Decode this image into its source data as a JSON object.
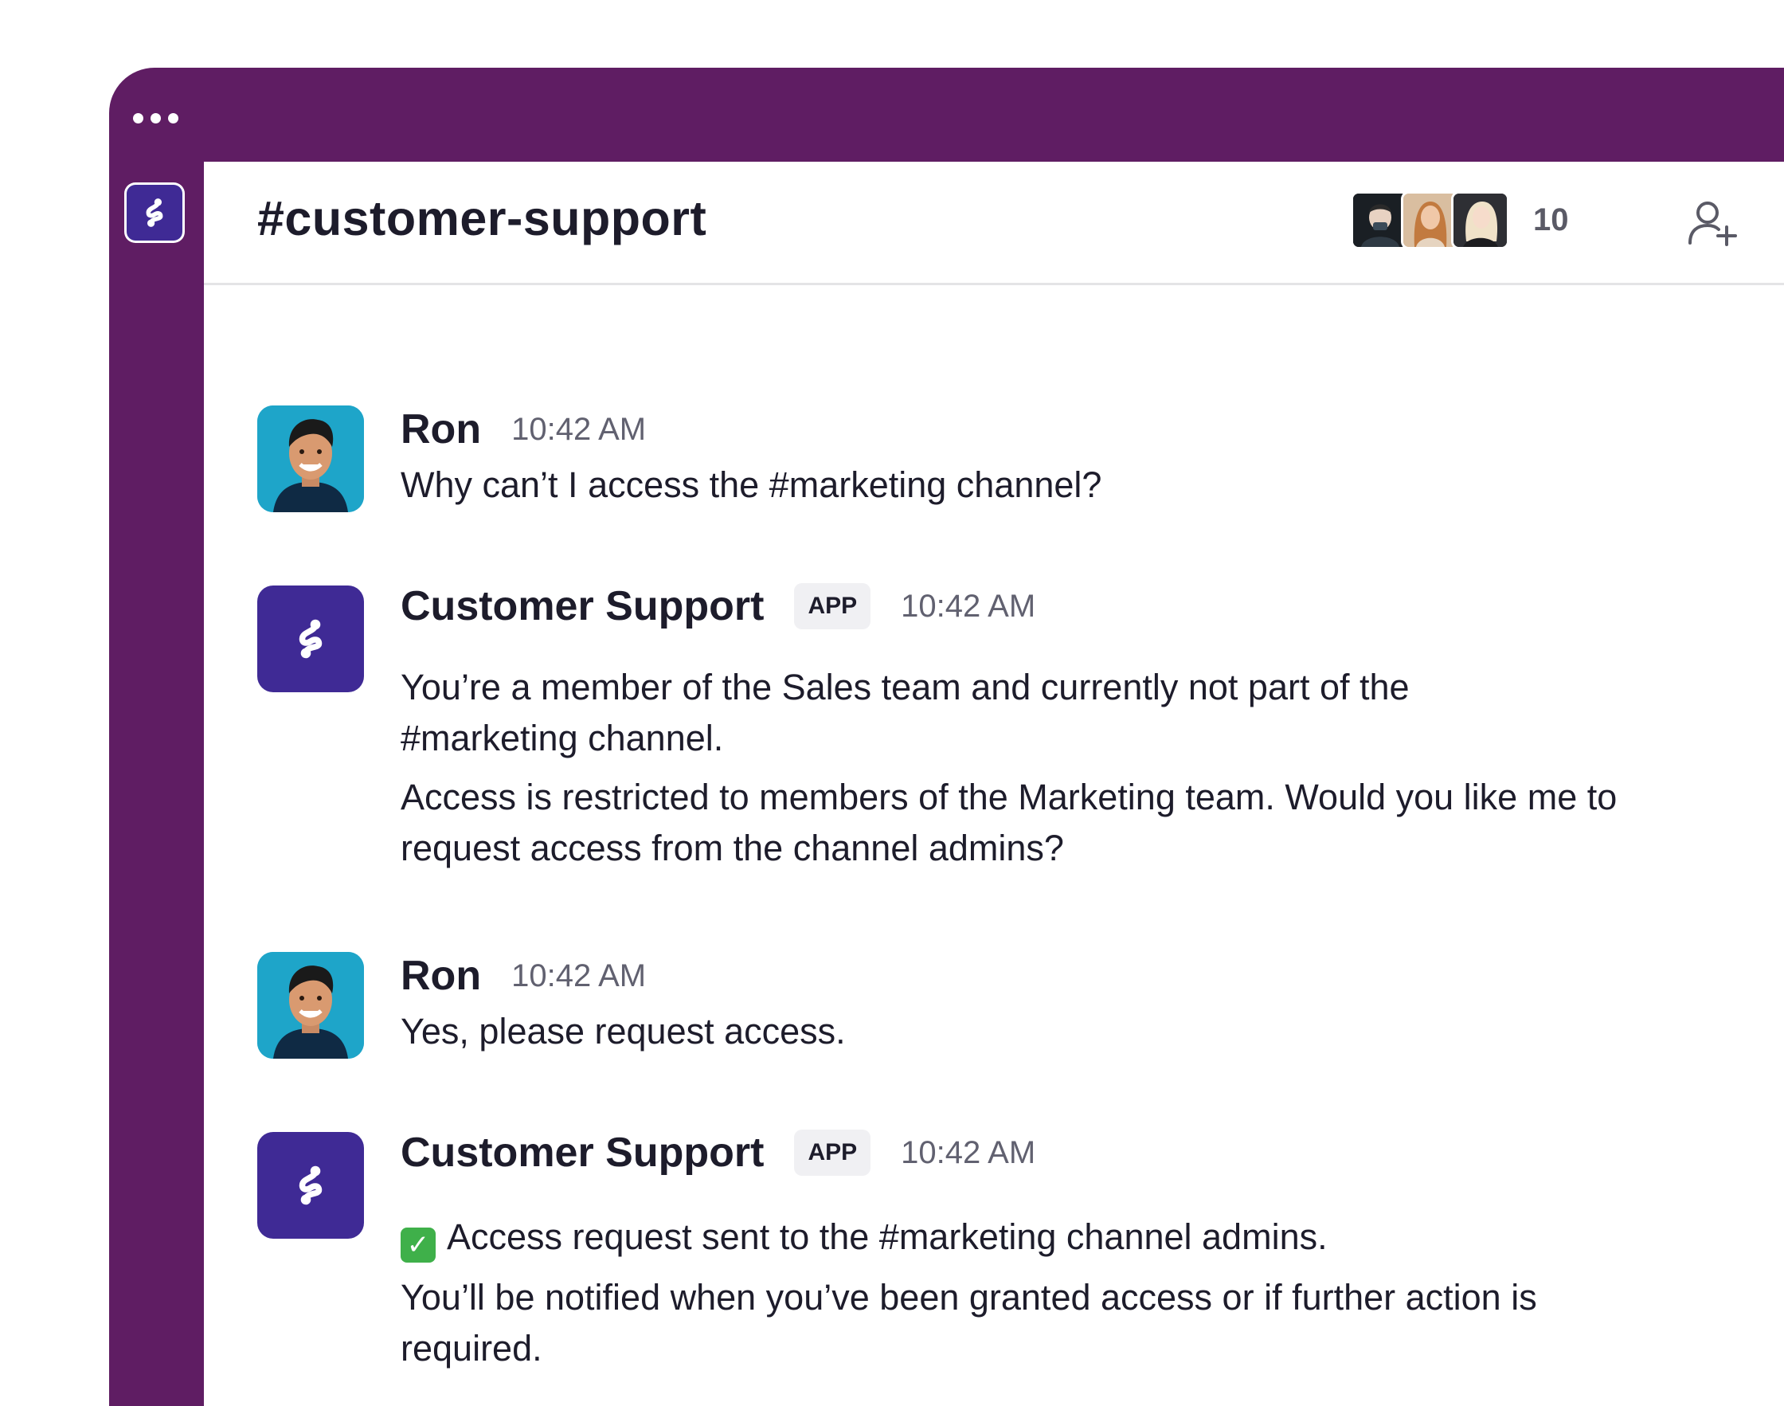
{
  "channel": {
    "title": "#customer-support",
    "member_count": "10",
    "member_avatars": [
      "member-avatar-1",
      "member-avatar-2",
      "member-avatar-3"
    ]
  },
  "icons": {
    "window_menu": "more-horizontal-icon",
    "workspace": "app-logo-icon",
    "add_member": "add-user-icon",
    "info": "info-icon"
  },
  "colors": {
    "chrome": "#5f1d63",
    "app_avatar": "#3f2a95",
    "user_avatar": "#1ea5c9"
  },
  "messages": [
    {
      "sender": "Ron",
      "time": "10:42 AM",
      "lines": [
        "Why can’t I access the #marketing channel?"
      ]
    },
    {
      "sender": "Customer Support",
      "badge": "APP",
      "time": "10:42 AM",
      "lines": [
        "You’re a member of the Sales team and currently not part of the #marketing channel.",
        "Access is restricted to members of the Marketing team. Would you like me to request access from the channel admins?"
      ]
    },
    {
      "sender": "Ron",
      "time": "10:42 AM",
      "lines": [
        "Yes, please request access."
      ]
    },
    {
      "sender": "Customer Support",
      "badge": "APP",
      "time": "10:42 AM",
      "emoji": "✓",
      "lines": [
        "Access request sent to the #marketing channel admins.",
        "You’ll be notified when you’ve been granted access or if further action is required."
      ]
    }
  ]
}
